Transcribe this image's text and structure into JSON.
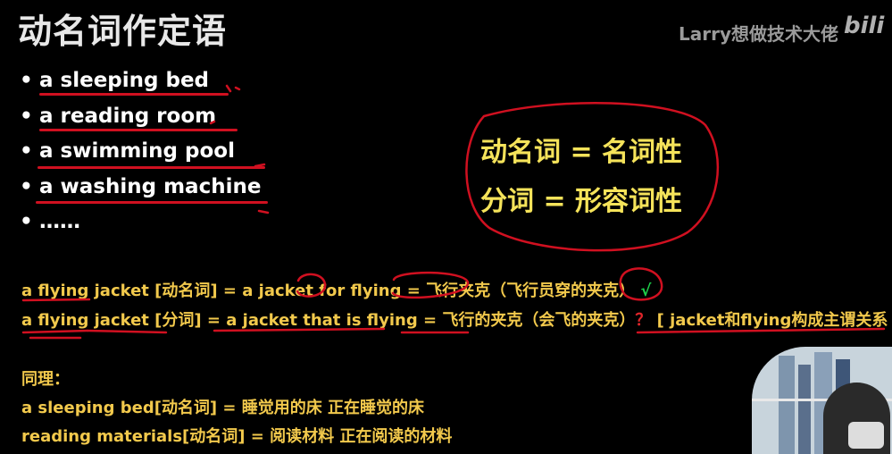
{
  "title": "动名词作定语",
  "watermark": "Larry想做技术大佬",
  "logo_text": "bilibili",
  "bullets": [
    "a sleeping bed",
    "a reading room",
    "a swimming pool",
    "a washing machine",
    "……"
  ],
  "claims": [
    "动名词 = 名词性",
    "分词 = 形容词性"
  ],
  "line1": {
    "text": "a flying jacket [动名词] = a jacket for flying = 飞行夹克（飞行员穿的夹克）",
    "tick": "√"
  },
  "line2": {
    "text": "a flying jacket [分词] = a jacket that is flying = 飞行的夹克（会飞的夹克）",
    "question": "？",
    "bracket": "[ jacket和flying构成主谓关系 ]"
  },
  "tongli": "同理：",
  "line3": "a sleeping bed[动名词] = 睡觉用的床  正在睡觉的床",
  "line4": "reading materials[动名词] = 阅读材料  正在阅读的材料",
  "colors": {
    "yellow": "#f2c94c",
    "red_annotation": "#d01020",
    "tick": "#1ecf4a",
    "background": "#000000"
  },
  "icons": [
    "bilibili-logo-icon",
    "webcam-feed"
  ]
}
